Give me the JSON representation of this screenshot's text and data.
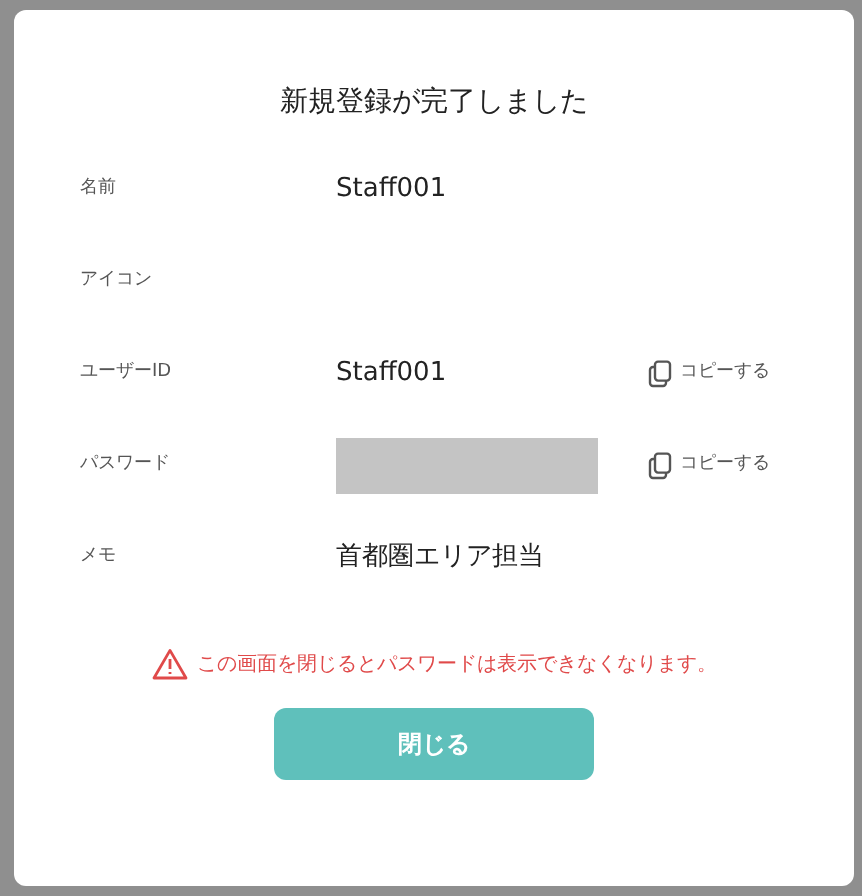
{
  "dialog": {
    "title": "新規登録が完了しました",
    "rows": [
      {
        "label": "名前",
        "kind": "text",
        "value": "Staff001"
      },
      {
        "label": "アイコン",
        "kind": "empty"
      },
      {
        "label": "ユーザーID",
        "kind": "text",
        "value": "Staff001",
        "copy": "コピーする"
      },
      {
        "label": "パスワード",
        "kind": "masked",
        "copy": "コピーする"
      },
      {
        "label": "メモ",
        "kind": "text",
        "value": "首都圏エリア担当"
      }
    ],
    "warning": "この画面を閉じるとパスワードは表示できなくなります。",
    "button": "閉じる"
  }
}
